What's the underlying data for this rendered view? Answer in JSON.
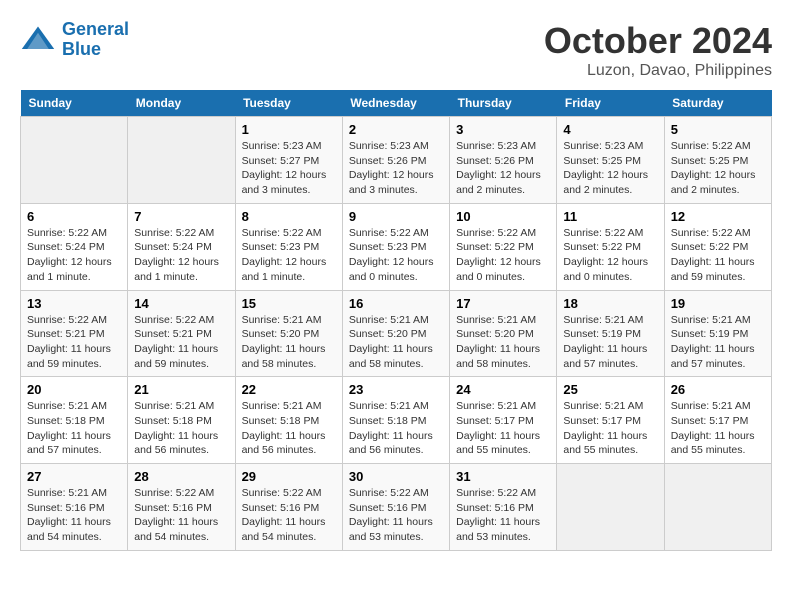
{
  "logo": {
    "line1": "General",
    "line2": "Blue"
  },
  "title": "October 2024",
  "subtitle": "Luzon, Davao, Philippines",
  "weekdays": [
    "Sunday",
    "Monday",
    "Tuesday",
    "Wednesday",
    "Thursday",
    "Friday",
    "Saturday"
  ],
  "weeks": [
    [
      {
        "day": "",
        "info": ""
      },
      {
        "day": "",
        "info": ""
      },
      {
        "day": "1",
        "info": "Sunrise: 5:23 AM\nSunset: 5:27 PM\nDaylight: 12 hours\nand 3 minutes."
      },
      {
        "day": "2",
        "info": "Sunrise: 5:23 AM\nSunset: 5:26 PM\nDaylight: 12 hours\nand 3 minutes."
      },
      {
        "day": "3",
        "info": "Sunrise: 5:23 AM\nSunset: 5:26 PM\nDaylight: 12 hours\nand 2 minutes."
      },
      {
        "day": "4",
        "info": "Sunrise: 5:23 AM\nSunset: 5:25 PM\nDaylight: 12 hours\nand 2 minutes."
      },
      {
        "day": "5",
        "info": "Sunrise: 5:22 AM\nSunset: 5:25 PM\nDaylight: 12 hours\nand 2 minutes."
      }
    ],
    [
      {
        "day": "6",
        "info": "Sunrise: 5:22 AM\nSunset: 5:24 PM\nDaylight: 12 hours\nand 1 minute."
      },
      {
        "day": "7",
        "info": "Sunrise: 5:22 AM\nSunset: 5:24 PM\nDaylight: 12 hours\nand 1 minute."
      },
      {
        "day": "8",
        "info": "Sunrise: 5:22 AM\nSunset: 5:23 PM\nDaylight: 12 hours\nand 1 minute."
      },
      {
        "day": "9",
        "info": "Sunrise: 5:22 AM\nSunset: 5:23 PM\nDaylight: 12 hours\nand 0 minutes."
      },
      {
        "day": "10",
        "info": "Sunrise: 5:22 AM\nSunset: 5:22 PM\nDaylight: 12 hours\nand 0 minutes."
      },
      {
        "day": "11",
        "info": "Sunrise: 5:22 AM\nSunset: 5:22 PM\nDaylight: 12 hours\nand 0 minutes."
      },
      {
        "day": "12",
        "info": "Sunrise: 5:22 AM\nSunset: 5:22 PM\nDaylight: 11 hours\nand 59 minutes."
      }
    ],
    [
      {
        "day": "13",
        "info": "Sunrise: 5:22 AM\nSunset: 5:21 PM\nDaylight: 11 hours\nand 59 minutes."
      },
      {
        "day": "14",
        "info": "Sunrise: 5:22 AM\nSunset: 5:21 PM\nDaylight: 11 hours\nand 59 minutes."
      },
      {
        "day": "15",
        "info": "Sunrise: 5:21 AM\nSunset: 5:20 PM\nDaylight: 11 hours\nand 58 minutes."
      },
      {
        "day": "16",
        "info": "Sunrise: 5:21 AM\nSunset: 5:20 PM\nDaylight: 11 hours\nand 58 minutes."
      },
      {
        "day": "17",
        "info": "Sunrise: 5:21 AM\nSunset: 5:20 PM\nDaylight: 11 hours\nand 58 minutes."
      },
      {
        "day": "18",
        "info": "Sunrise: 5:21 AM\nSunset: 5:19 PM\nDaylight: 11 hours\nand 57 minutes."
      },
      {
        "day": "19",
        "info": "Sunrise: 5:21 AM\nSunset: 5:19 PM\nDaylight: 11 hours\nand 57 minutes."
      }
    ],
    [
      {
        "day": "20",
        "info": "Sunrise: 5:21 AM\nSunset: 5:18 PM\nDaylight: 11 hours\nand 57 minutes."
      },
      {
        "day": "21",
        "info": "Sunrise: 5:21 AM\nSunset: 5:18 PM\nDaylight: 11 hours\nand 56 minutes."
      },
      {
        "day": "22",
        "info": "Sunrise: 5:21 AM\nSunset: 5:18 PM\nDaylight: 11 hours\nand 56 minutes."
      },
      {
        "day": "23",
        "info": "Sunrise: 5:21 AM\nSunset: 5:18 PM\nDaylight: 11 hours\nand 56 minutes."
      },
      {
        "day": "24",
        "info": "Sunrise: 5:21 AM\nSunset: 5:17 PM\nDaylight: 11 hours\nand 55 minutes."
      },
      {
        "day": "25",
        "info": "Sunrise: 5:21 AM\nSunset: 5:17 PM\nDaylight: 11 hours\nand 55 minutes."
      },
      {
        "day": "26",
        "info": "Sunrise: 5:21 AM\nSunset: 5:17 PM\nDaylight: 11 hours\nand 55 minutes."
      }
    ],
    [
      {
        "day": "27",
        "info": "Sunrise: 5:21 AM\nSunset: 5:16 PM\nDaylight: 11 hours\nand 54 minutes."
      },
      {
        "day": "28",
        "info": "Sunrise: 5:22 AM\nSunset: 5:16 PM\nDaylight: 11 hours\nand 54 minutes."
      },
      {
        "day": "29",
        "info": "Sunrise: 5:22 AM\nSunset: 5:16 PM\nDaylight: 11 hours\nand 54 minutes."
      },
      {
        "day": "30",
        "info": "Sunrise: 5:22 AM\nSunset: 5:16 PM\nDaylight: 11 hours\nand 53 minutes."
      },
      {
        "day": "31",
        "info": "Sunrise: 5:22 AM\nSunset: 5:16 PM\nDaylight: 11 hours\nand 53 minutes."
      },
      {
        "day": "",
        "info": ""
      },
      {
        "day": "",
        "info": ""
      }
    ]
  ]
}
